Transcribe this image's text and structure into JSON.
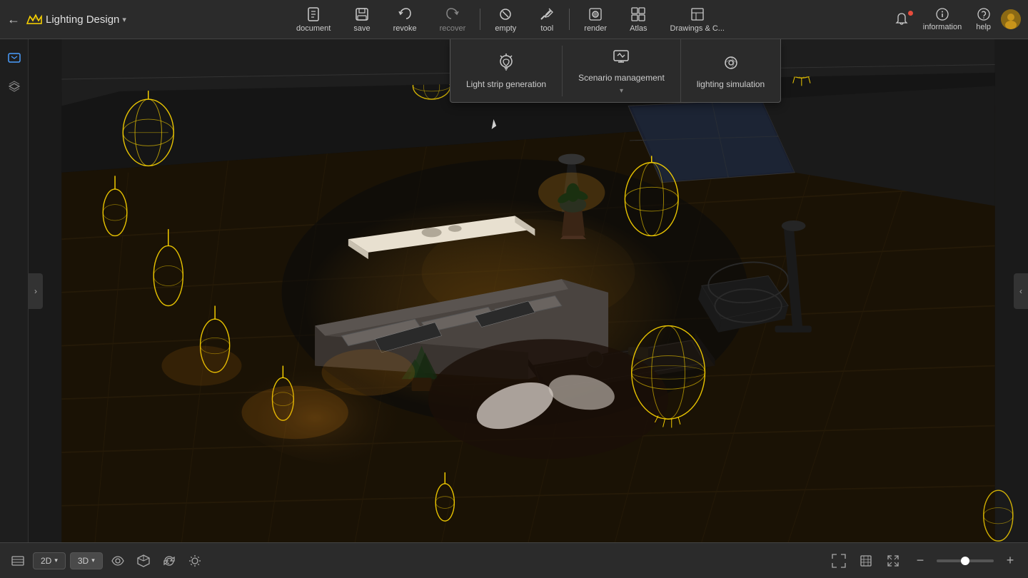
{
  "app": {
    "title": "Lighting Design",
    "dropdown_arrow": "▾"
  },
  "topbar": {
    "tools": [
      {
        "id": "document",
        "label": "document",
        "icon": "document"
      },
      {
        "id": "save",
        "label": "save",
        "icon": "save"
      },
      {
        "id": "revoke",
        "label": "revoke",
        "icon": "undo"
      },
      {
        "id": "recover",
        "label": "recover",
        "icon": "redo"
      },
      {
        "id": "empty",
        "label": "empty",
        "icon": "empty"
      },
      {
        "id": "tool",
        "label": "tool",
        "icon": "tool"
      },
      {
        "id": "render",
        "label": "render",
        "icon": "render"
      },
      {
        "id": "atlas",
        "label": "Atlas",
        "icon": "atlas"
      },
      {
        "id": "drawings",
        "label": "Drawings & C...",
        "icon": "drawings"
      }
    ]
  },
  "subtoolbar": {
    "items": [
      {
        "id": "light-strip",
        "label": "Light strip generation",
        "icon": "lightstrip",
        "has_caret": false
      },
      {
        "id": "scenario",
        "label": "Scenario management",
        "icon": "scenario",
        "has_caret": true
      },
      {
        "id": "simulation",
        "label": "lighting simulation",
        "icon": "simulation",
        "has_caret": false
      }
    ]
  },
  "topbar_right": {
    "information_label": "information",
    "help_label": "help"
  },
  "bottombar": {
    "view_2d": "2D",
    "view_3d": "3D",
    "zoom_minus": "−",
    "zoom_plus": "+"
  },
  "colors": {
    "accent": "#ffd700",
    "bg_dark": "#1a1a1a",
    "toolbar_bg": "#2b2b2b",
    "border": "#444444"
  }
}
